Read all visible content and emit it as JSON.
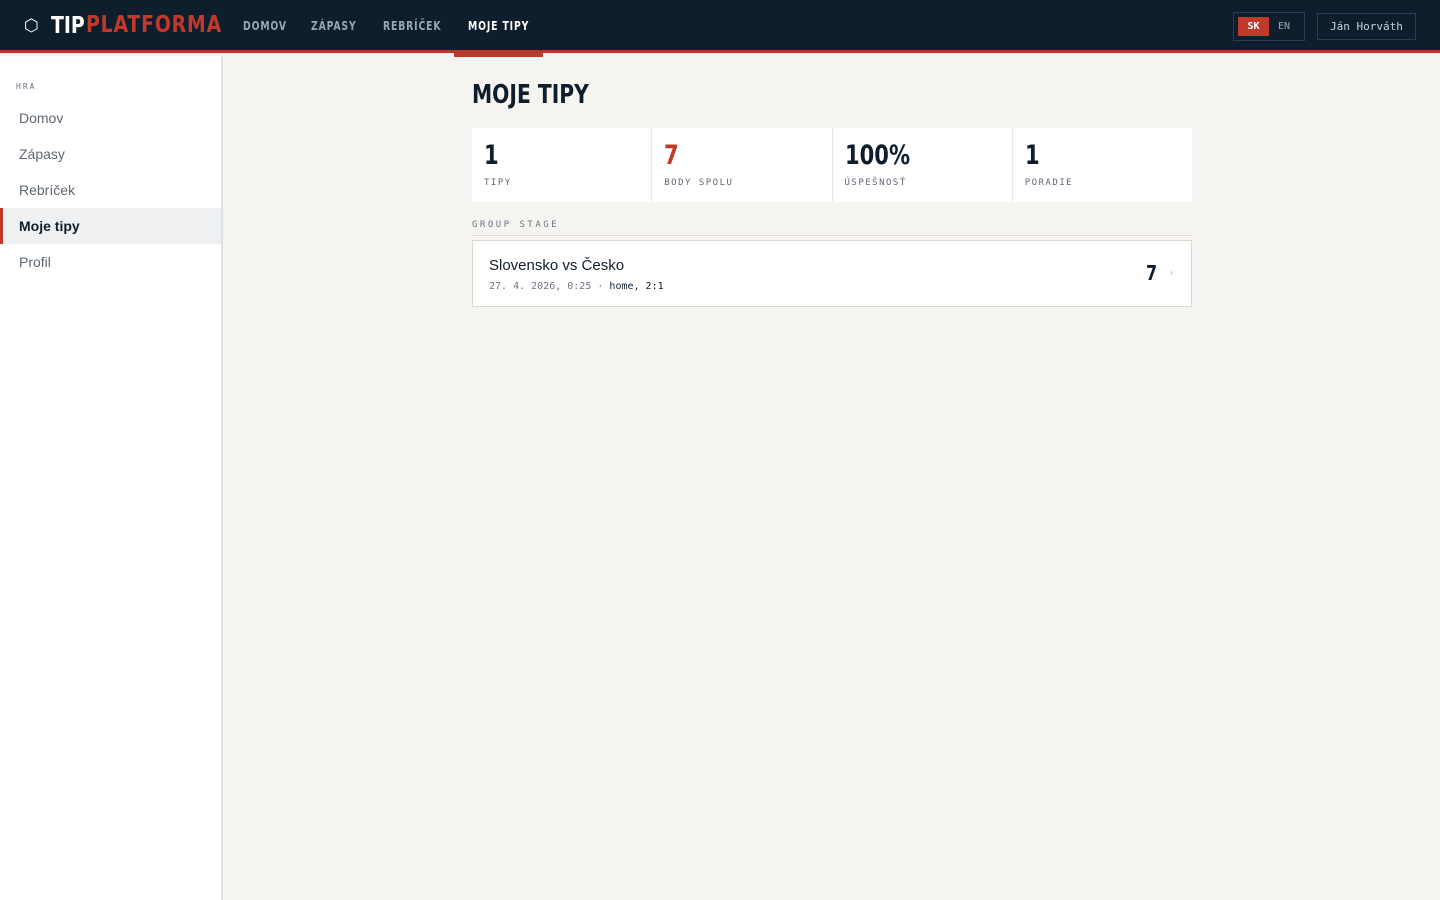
{
  "header": {
    "logo_icon": "⬡",
    "logo_primary": "TIP",
    "logo_secondary": "PLATFORMA",
    "nav": [
      {
        "label": "DOMOV"
      },
      {
        "label": "ZÁPASY"
      },
      {
        "label": "REBRÍČEK"
      },
      {
        "label": "MOJE TIPY"
      }
    ],
    "lang_active": "SK",
    "lang_other": "EN",
    "user_name": "Ján Horváth"
  },
  "sidebar": {
    "section_label": "HRA",
    "items": [
      {
        "label": "Domov"
      },
      {
        "label": "Zápasy"
      },
      {
        "label": "Rebríček"
      },
      {
        "label": "Moje tipy"
      },
      {
        "label": "Profil"
      }
    ]
  },
  "main": {
    "title": "MOJE TIPY",
    "stats": [
      {
        "value": "1",
        "label": "TIPY"
      },
      {
        "value": "7",
        "label": "BODY SPOLU"
      },
      {
        "value": "100%",
        "label": "ÚSPEŠNOSŤ"
      },
      {
        "value": "1",
        "label": "PORADIE"
      }
    ],
    "group_label": "GROUP STAGE",
    "tips": [
      {
        "match": "Slovensko vs Česko",
        "datetime": "27. 4. 2026, 0:25",
        "separator": " · ",
        "pick": "home, 2:1",
        "points": "7",
        "chevron": "›"
      }
    ]
  },
  "colors": {
    "navy": "#0e1e2d",
    "accent": "#c0392b",
    "background": "#f6f4f0"
  }
}
